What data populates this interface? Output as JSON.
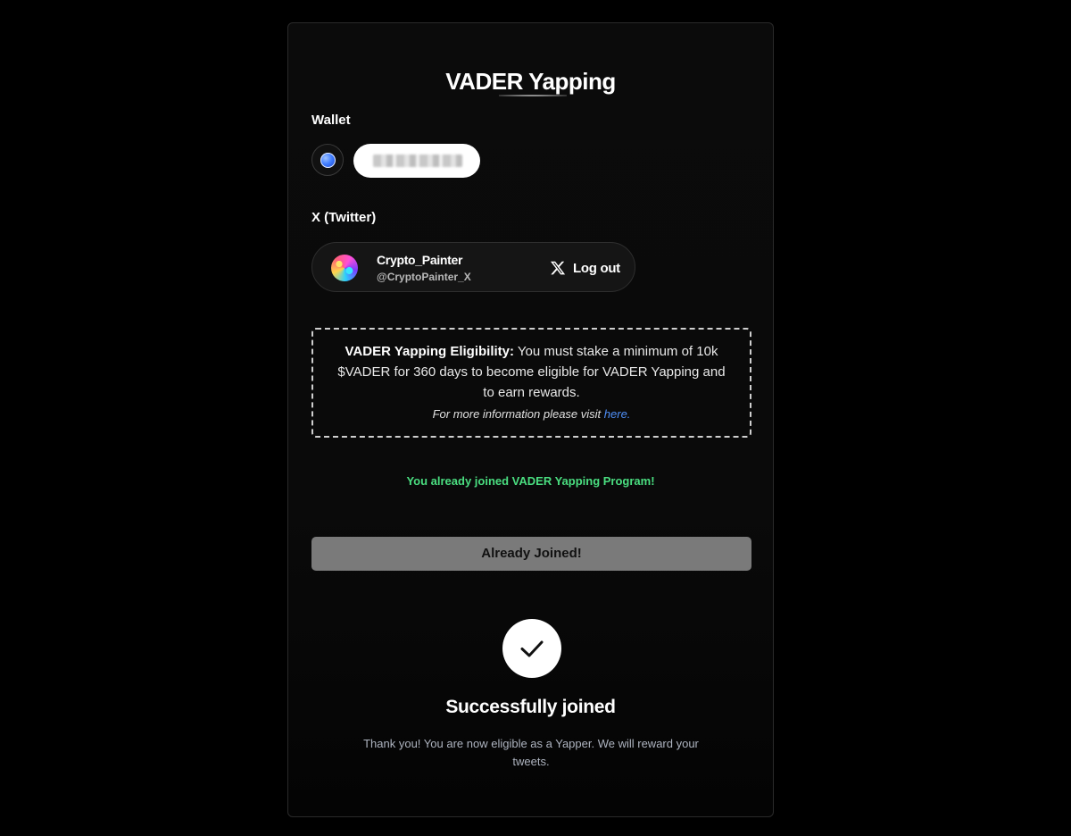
{
  "header": {
    "title": "VADER Yapping"
  },
  "wallet": {
    "label": "Wallet",
    "icon": "wallet-orb-icon",
    "address_blurred": true
  },
  "twitter": {
    "label": "X (Twitter)",
    "display_name": "Crypto_Painter",
    "handle": "@CryptoPainter_X",
    "logout_icon": "x-logo-icon",
    "logout_label": "Log out"
  },
  "eligibility": {
    "heading": "VADER Yapping Eligibility:",
    "body": "You must stake a minimum of 10k $VADER for 360 days to become eligible for VADER Yapping and to earn rewards.",
    "info_prefix": "For more information please visit",
    "info_link": "here."
  },
  "status": {
    "joined_message": "You already joined VADER Yapping Program!",
    "button_label": "Already Joined!"
  },
  "success": {
    "icon": "checkmark-icon",
    "title": "Successfully joined",
    "description": "Thank you! You are now eligible as a Yapper. We will reward your tweets."
  },
  "colors": {
    "background": "#000000",
    "success_green": "#4ade80",
    "link_blue": "#4f8ff7",
    "disabled_button": "#7a7a7a"
  }
}
